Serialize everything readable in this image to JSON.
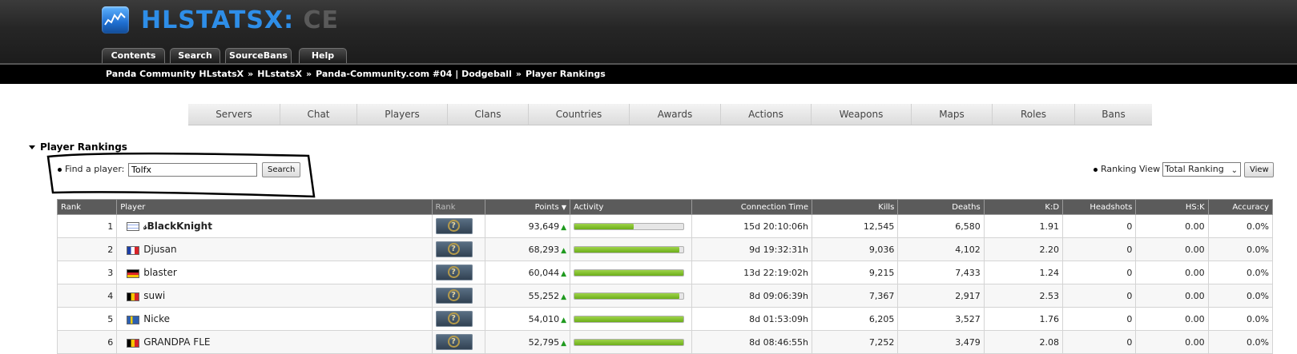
{
  "header": {
    "logo_main": "HLSTATSX",
    "logo_sep": ":",
    "logo_ce": "CE",
    "tabs": [
      {
        "label": "Contents"
      },
      {
        "label": "Search"
      },
      {
        "label": "SourceBans"
      },
      {
        "label": "Help"
      }
    ],
    "breadcrumb": [
      "Panda Community HLstatsX",
      "HLstatsX",
      "Panda-Community.com #04 | Dodgeball",
      "Player Rankings"
    ],
    "breadcrumb_separator": "»"
  },
  "subnav": [
    "Servers",
    "Chat",
    "Players",
    "Clans",
    "Countries",
    "Awards",
    "Actions",
    "Weapons",
    "Maps",
    "Roles",
    "Bans"
  ],
  "section": {
    "title": "Player Rankings",
    "find_label": "Find a player:",
    "find_value": "Tolfx",
    "search_button": "Search",
    "ranking_view_label": "Ranking View",
    "ranking_view_selected": "Total Ranking",
    "view_button": "View"
  },
  "table": {
    "headers": [
      "Rank",
      "Player",
      "Rank",
      "Points",
      "Activity",
      "Connection Time",
      "Kills",
      "Deaths",
      "K:D",
      "Headshots",
      "HS:K",
      "Accuracy"
    ],
    "sort_indicator": "▼",
    "rows": [
      {
        "rank": "1",
        "player": "𝓈BlackKnight",
        "bold": true,
        "flag": "il",
        "points": "93,649",
        "activity": 0.54,
        "time": "15d 20:10:06h",
        "kills": "12,545",
        "deaths": "6,580",
        "kd": "1.91",
        "hs": "0",
        "hsk": "0.00",
        "acc": "0.0%"
      },
      {
        "rank": "2",
        "player": "Djusan",
        "bold": false,
        "flag": "fr",
        "points": "68,293",
        "activity": 0.96,
        "time": "9d 19:32:31h",
        "kills": "9,036",
        "deaths": "4,102",
        "kd": "2.20",
        "hs": "0",
        "hsk": "0.00",
        "acc": "0.0%"
      },
      {
        "rank": "3",
        "player": "blaster",
        "bold": false,
        "flag": "de",
        "points": "60,044",
        "activity": 1.0,
        "time": "13d 22:19:02h",
        "kills": "9,215",
        "deaths": "7,433",
        "kd": "1.24",
        "hs": "0",
        "hsk": "0.00",
        "acc": "0.0%"
      },
      {
        "rank": "4",
        "player": "suwi",
        "bold": false,
        "flag": "be",
        "points": "55,252",
        "activity": 0.96,
        "time": "8d 09:06:39h",
        "kills": "7,367",
        "deaths": "2,917",
        "kd": "2.53",
        "hs": "0",
        "hsk": "0.00",
        "acc": "0.0%"
      },
      {
        "rank": "5",
        "player": "Nicke",
        "bold": false,
        "flag": "se",
        "points": "54,010",
        "activity": 1.0,
        "time": "8d 01:53:09h",
        "kills": "6,205",
        "deaths": "3,527",
        "kd": "1.76",
        "hs": "0",
        "hsk": "0.00",
        "acc": "0.0%"
      },
      {
        "rank": "6",
        "player": "GRANDPA FLE",
        "bold": false,
        "flag": "be",
        "points": "52,795",
        "activity": 1.0,
        "time": "8d 08:46:55h",
        "kills": "7,252",
        "deaths": "3,479",
        "kd": "2.08",
        "hs": "0",
        "hsk": "0.00",
        "acc": "0.0%"
      }
    ]
  },
  "colors": {
    "accent": "#2e8ee8",
    "activity_bar": "#7bbd22",
    "trend_up": "#1f9a1f"
  }
}
